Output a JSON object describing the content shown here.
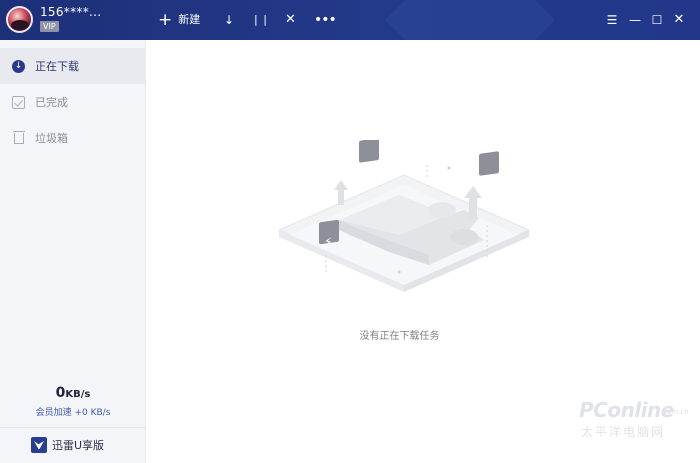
{
  "titlebar": {
    "user_name": "156****...",
    "vip_label": "VIP",
    "new_label": "新建",
    "icons": {
      "new": "plus-icon",
      "download": "arrow-down-icon",
      "pause": "pause-icon",
      "delete": "close-icon",
      "more": "more-icon",
      "menu": "menu-icon",
      "minimize": "minimize-icon",
      "maximize": "maximize-icon",
      "close": "close-icon"
    },
    "colors": {
      "background": "#1f3380",
      "accent": "#2c4698"
    }
  },
  "sidebar": {
    "items": [
      {
        "label": "正在下载",
        "icon": "download-circle-icon",
        "active": true
      },
      {
        "label": "已完成",
        "icon": "check-box-icon",
        "active": false
      },
      {
        "label": "垃圾箱",
        "icon": "trash-icon",
        "active": false
      }
    ],
    "speed_value": "0",
    "speed_unit": "KB/s",
    "boost_text": "会员加速 +0 KB/s",
    "uversion_label": "迅雷U享版"
  },
  "main": {
    "empty_text": "没有正在下载任务"
  },
  "watermark": {
    "brand": "PConline",
    "domain": ".com.cn",
    "cn": "太平洋电脑网"
  }
}
